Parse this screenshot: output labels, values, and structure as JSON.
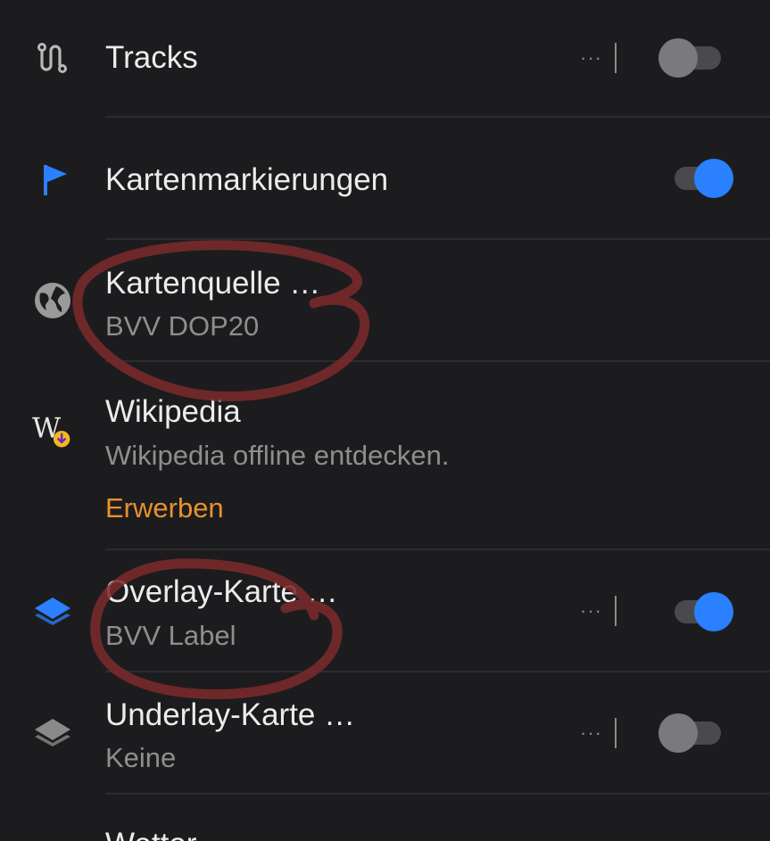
{
  "items": [
    {
      "title": "Tracks",
      "more": "···",
      "toggle": "off",
      "icon": "track-route-icon"
    },
    {
      "title": "Kartenmarkierungen",
      "toggle": "on",
      "icon": "flag-icon"
    },
    {
      "title": "Kartenquelle …",
      "subtitle": "BVV DOP20",
      "icon": "globe-icon"
    },
    {
      "title": "Wikipedia",
      "subtitle": "Wikipedia offline entdecken.",
      "action": "Erwerben",
      "icon": "wikipedia-download-icon"
    },
    {
      "title": "Overlay-Karte …",
      "subtitle": "BVV Label",
      "more": "···",
      "toggle": "on",
      "icon": "layers-overlay-icon"
    },
    {
      "title": "Underlay-Karte …",
      "subtitle": "Keine",
      "more": "···",
      "toggle": "off",
      "icon": "layers-underlay-icon"
    },
    {
      "title": "Wetter"
    }
  ],
  "colors": {
    "background": "#1c1c1e",
    "accent_blue": "#2a80ff",
    "action_orange": "#e8912f",
    "annotation_red": "#7a2a2c"
  }
}
